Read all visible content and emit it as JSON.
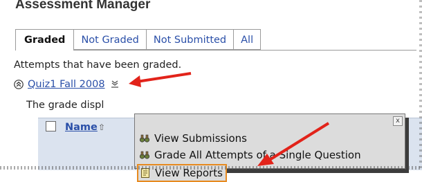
{
  "page": {
    "title": "Assessment Manager"
  },
  "tabs": [
    {
      "label": "Graded",
      "active": true
    },
    {
      "label": "Not Graded",
      "active": false
    },
    {
      "label": "Not Submitted",
      "active": false
    },
    {
      "label": "All",
      "active": false
    }
  ],
  "subtitle": "Attempts that have been graded.",
  "quiz": {
    "label": "Quiz1 Fall 2008"
  },
  "grade_text": "The grade displ",
  "table": {
    "name_header": "Name"
  },
  "popup": {
    "items": [
      {
        "label": "View Submissions",
        "icon": "binoculars-icon"
      },
      {
        "label": "Grade All Attempts of a Single Question",
        "icon": "binoculars-icon"
      },
      {
        "label": "View Reports",
        "icon": "report-icon"
      }
    ],
    "close": "x"
  },
  "colors": {
    "link": "#2a4fa8",
    "highlight_box": "#e78a1f",
    "arrow": "#e2231a",
    "popup_bg": "#dcdcdc",
    "table_header_bg": "#dbe3ef"
  }
}
